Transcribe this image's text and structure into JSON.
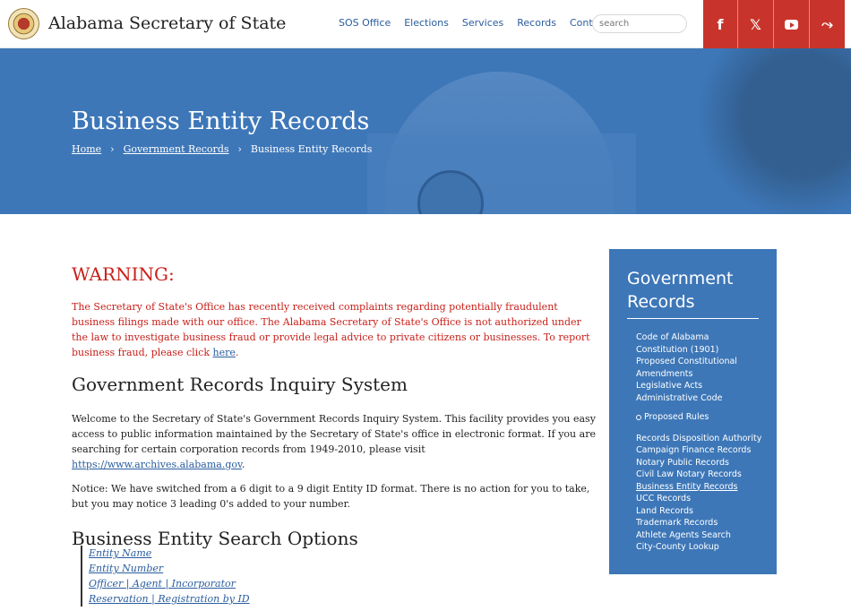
{
  "header": {
    "site_title": "Alabama Secretary of State",
    "nav": [
      "SOS Office",
      "Elections",
      "Services",
      "Records",
      "Contact"
    ],
    "search_placeholder": "search",
    "social": {
      "facebook": "f",
      "x": "𝕏",
      "rss": "⤳"
    }
  },
  "hero": {
    "title": "Business Entity Records",
    "breadcrumb": [
      "Home",
      "Government Records",
      "Business Entity Records"
    ],
    "separator": "›"
  },
  "main": {
    "warning_title": "WARNING:",
    "warning_text": "The Secretary of State's Office has recently received complaints regarding potentially fraudulent business filings made with our office. The Alabama Secretary of State's Office is not authorized under the law to investigate business fraud or provide legal advice to private citizens or businesses. To report business fraud, please click",
    "warning_link": "here",
    "inquiry_heading": "Government Records Inquiry System",
    "inquiry_text": "Welcome to the Secretary of State's Government Records Inquiry System. This facility provides you easy access to public information maintained by the Secretary of State's office in electronic format. If you are searching for certain corporation records from 1949-2010, please visit",
    "inquiry_link": "https://www.archives.alabama.gov",
    "notice_text": "Notice: We have switched from a 6 digit to a 9 digit Entity ID format. There is no action for you to take, but you may notice 3 leading 0's added to your number.",
    "options_heading": "Business Entity Search Options",
    "options": [
      "Entity Name",
      "Entity Number",
      "Officer | Agent | Incorporator",
      "Reservation | Registration by ID"
    ]
  },
  "sidebar": {
    "title": "Government Records",
    "items_top": [
      "Code of Alabama",
      "Constitution (1901)",
      "Proposed Constitutional",
      "Amendments",
      "Legislative Acts",
      "Administrative Code"
    ],
    "sub_item": "Proposed Rules",
    "items_bottom": [
      "Records Disposition Authority",
      "Campaign Finance Records",
      "Notary Public Records",
      "Civil Law Notary Records",
      "Business Entity Records",
      "UCC Records",
      "Land Records",
      "Trademark Records",
      "Athlete Agents Search",
      "City-County Lookup"
    ]
  }
}
